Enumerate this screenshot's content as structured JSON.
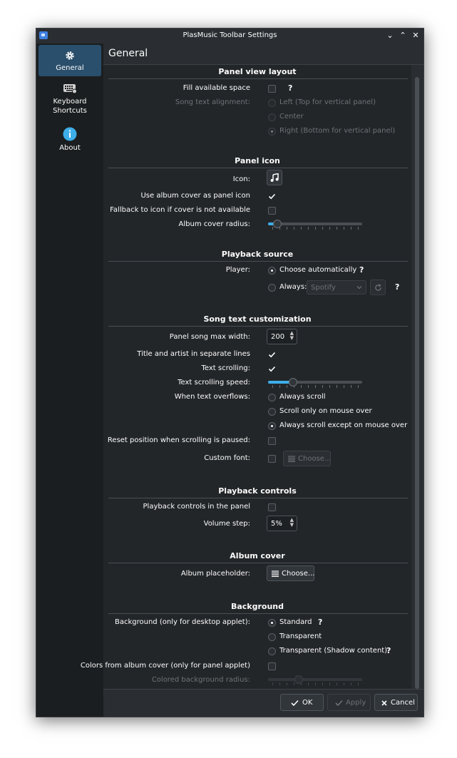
{
  "window": {
    "title": "PlasMusic Toolbar Settings"
  },
  "sidebar": {
    "items": [
      {
        "label": "General",
        "icon": "gear-icon",
        "active": true
      },
      {
        "label": "Keyboard\nShortcuts",
        "icon": "keyboard-icon"
      },
      {
        "label": "About",
        "icon": "info-icon"
      }
    ]
  },
  "page": {
    "title": "General"
  },
  "sections": {
    "panel_view_layout": {
      "title": "Panel view layout",
      "fill_label": "Fill available space",
      "align_label": "Song text alignment:",
      "align_left": "Left (Top for vertical panel)",
      "align_center": "Center",
      "align_right": "Right (Bottom for vertical panel)"
    },
    "panel_icon": {
      "title": "Panel icon",
      "icon_label": "Icon:",
      "use_cover_label": "Use album cover as panel icon",
      "fallback_label": "Fallback to icon if cover is not available",
      "radius_label": "Album cover radius:",
      "radius_value": 0.08
    },
    "playback_source": {
      "title": "Playback source",
      "player_label": "Player:",
      "choose_auto": "Choose automatically",
      "always": "Always:",
      "player_combo": "Spotify"
    },
    "song_text": {
      "title": "Song text customization",
      "max_width_label": "Panel song max width:",
      "max_width_value": "200",
      "separate_lines_label": "Title and artist in separate lines",
      "scrolling_label": "Text scrolling:",
      "speed_label": "Text scrolling speed:",
      "speed_value": 0.25,
      "overflow_label": "When text overflows:",
      "overflow_1": "Always scroll",
      "overflow_2": "Scroll only on mouse over",
      "overflow_3": "Always scroll except on mouse over",
      "reset_label": "Reset position when scrolling is paused:",
      "custom_font_label": "Custom font:",
      "choose_button": "Choose..."
    },
    "playback_controls": {
      "title": "Playback controls",
      "in_panel_label": "Playback controls in the panel",
      "volume_label": "Volume step:",
      "volume_value": "5%"
    },
    "album_cover": {
      "title": "Album cover",
      "placeholder_label": "Album placeholder:",
      "choose_button": "Choose..."
    },
    "background": {
      "title": "Background",
      "bg_label": "Background (only for desktop applet):",
      "standard": "Standard",
      "transparent": "Transparent",
      "transparent_shadow": "Transparent (Shadow content)",
      "colors_label": "Colors from album cover (only for panel applet)",
      "radius_label": "Colored background radius:"
    }
  },
  "help": "?",
  "footer": {
    "ok": "OK",
    "apply": "Apply",
    "cancel": "Cancel"
  },
  "colors": {
    "accent": "#3daee9",
    "window_bg": "#232629",
    "sidebar_active": "#2a4f6c"
  }
}
